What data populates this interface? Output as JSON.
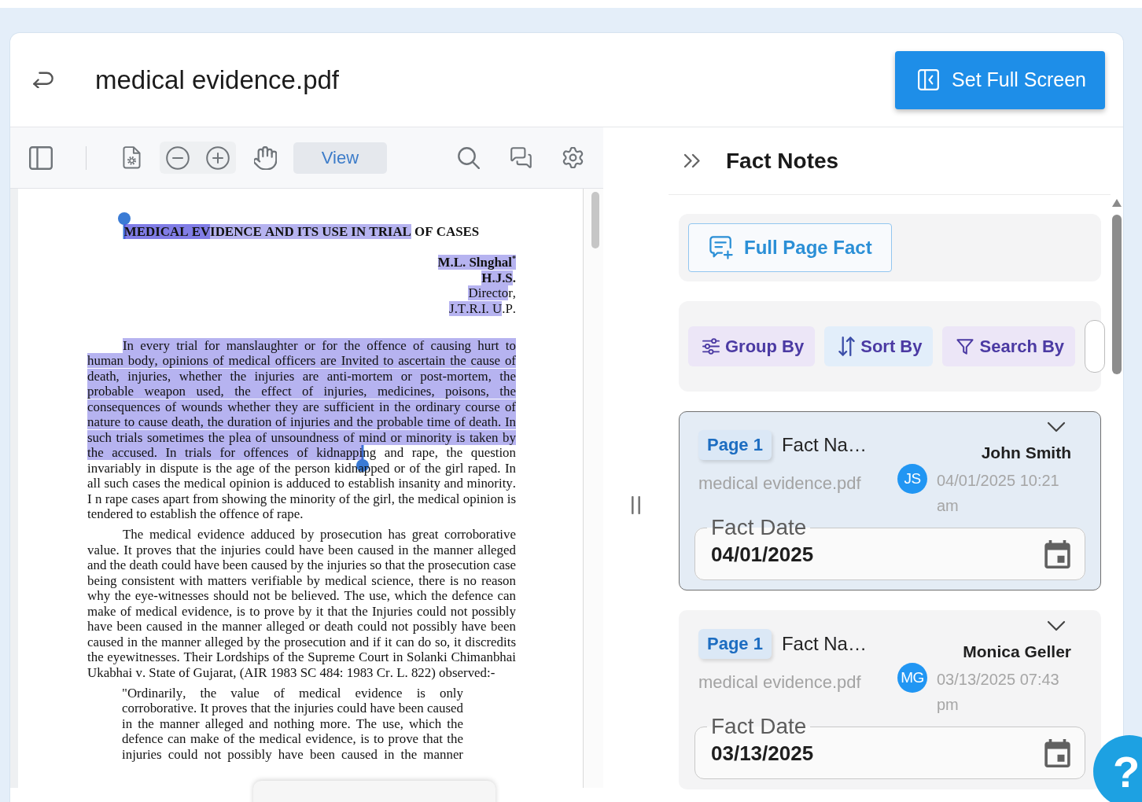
{
  "header": {
    "title": "medical evidence.pdf",
    "fullscreen_button": "Set Full Screen"
  },
  "viewer": {
    "mode_button": "View",
    "document": {
      "title": [
        {
          "text": "MEDICAL EV",
          "selected": true,
          "annotated": true
        },
        {
          "text": "IDENCE AND ITS USE IN TRIAL",
          "selected": true,
          "annotated": false
        },
        {
          "text": " OF CASES",
          "selected": false,
          "annotated": false
        }
      ],
      "author_lines": [
        {
          "bold": true,
          "segments": [
            {
              "text": "M.L. Slnghal$^{*}$",
              "selected": true
            }
          ]
        },
        {
          "bold": true,
          "segments": [
            {
              "text": "H.J.S",
              "selected": true
            },
            {
              "text": ".",
              "selected": false
            }
          ]
        },
        {
          "bold": false,
          "segments": [
            {
              "text": "Directo",
              "selected": true
            },
            {
              "text": "r,",
              "selected": false
            }
          ]
        },
        {
          "bold": false,
          "segments": [
            {
              "text": "J.T.R.I. U",
              "selected": true
            },
            {
              "text": ".P.",
              "selected": false
            }
          ]
        }
      ],
      "paragraphs": [
        {
          "kind": "body",
          "segments": [
            {
              "text": "In every trial for manslaughter or for the offence of causing hurt to human body, opinions of medical officers are Invited to ascertain the cause of death, injuries, whether the injuries are anti-mortem or post-mortem, the probable weapon used, the effect of injuries, medicines, poisons, the consequences of wounds whether they are sufficient in the ordinary course of nature to cause death, the duration of injuries and the probable time of death. In such trials sometimes the plea of unsoundness of mind or minority is taken by the accused. In trials for offences of kidnappi",
              "selected": true
            },
            {
              "text": "ng and rape, the question invariably in dispute is the age of the person kidnapped or of the girl raped. In all such cases the medical opinion is adduced to establish insanity and minority. I n rape cases apart from showing the minority of the girl, the medical opinion is tendered to establish the offence of rape.",
              "selected": false
            }
          ]
        },
        {
          "kind": "body",
          "segments": [
            {
              "text": "The medical evidence adduced by prosecution has great corroborative value. It proves that the injuries could have been caused in the manner alleged and the death could have been caused by the injuries so that the prosecution case being consistent with matters verifiable by medical science, there is no reason why the eye-witnesses should not be believed. The use, which the defence can make of medical evidence, is to prove by it that the Injuries could not possibly have been caused in the manner alleged or death could not possibly have been caused in the manner alleged by the prosecution and if it can do so, it discredits the eyewitnesses. Their Lordships of the Supreme Court in Solanki Chimanbhai Ukabhai v. State of Gujarat, (AIR 1983 SC 484: 1983 Cr. L. 822) observed:-",
              "selected": false
            }
          ]
        },
        {
          "kind": "quote",
          "cut_off": true,
          "segments": [
            {
              "text": "\"Ordinarily, the value of medical evidence is only corroborative. It proves that the injuries could have been caused in the manner alleged and nothing more. The use, which the defence can make of the medical evidence, is to prove that the injuries could not possibly have been caused in the manner",
              "selected": false
            }
          ]
        }
      ]
    }
  },
  "fact_notes": {
    "title": "Fact Notes",
    "full_page_button": "Full Page Fact",
    "filters": [
      {
        "label": "Group By",
        "kind": "group",
        "color": "#ece6f7"
      },
      {
        "label": "Sort By",
        "kind": "sort",
        "color": "#e2eefa"
      },
      {
        "label": "Search By",
        "kind": "search",
        "color": "#ece6f7"
      }
    ],
    "facts": [
      {
        "page": "Page 1",
        "name": "Fact Na…",
        "author": "John Smith",
        "initials": "JS",
        "file": "medical evidence.pdf",
        "timestamp": "04/01/2025 10:21 am",
        "date": {
          "label": "Fact Date",
          "value": "04/01/2025"
        },
        "selected": true
      },
      {
        "page": "Page 1",
        "name": "Fact Na…",
        "author": "Monica Geller",
        "initials": "MG",
        "file": "medical evidence.pdf",
        "timestamp": "03/13/2025 07:43 pm",
        "date": {
          "label": "Fact Date",
          "value": "03/13/2025"
        },
        "selected": false
      }
    ]
  },
  "help_button": "?"
}
